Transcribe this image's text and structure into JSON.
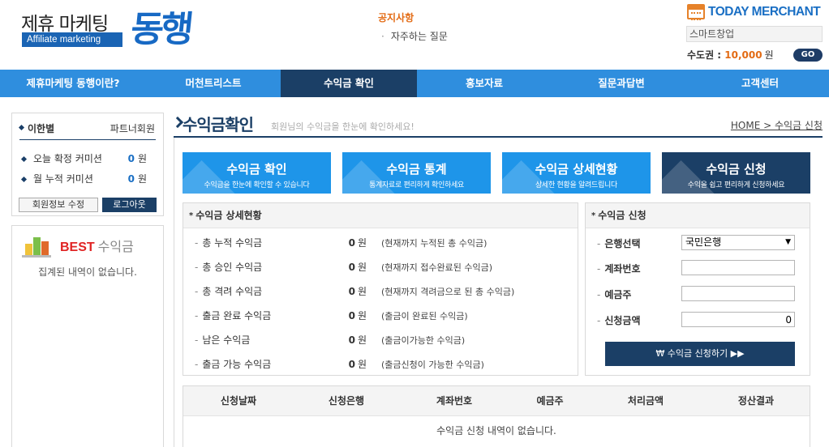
{
  "header": {
    "logo_main": "제휴 마케팅",
    "logo_sub": "Affiliate marketing",
    "logo_big": "동행",
    "notice_title": "공지사항",
    "notice_item": "자주하는 질문",
    "merchant_logo": "TODAY MERCHANT",
    "startup_text": "스마트창업",
    "sudo_label": "수도권 :",
    "sudo_value": "10,000",
    "sudo_unit": "원",
    "go_label": "GO"
  },
  "nav": {
    "items": [
      {
        "label": "제휴마케팅 동행이란?"
      },
      {
        "label": "머천트리스트"
      },
      {
        "label": "수익금 확인"
      },
      {
        "label": "홍보자료"
      },
      {
        "label": "질문과답변"
      },
      {
        "label": "고객센터"
      }
    ],
    "active_color": "#1b3f66",
    "bar_color": "#2f8ede"
  },
  "sidebar": {
    "member_name": "이한별",
    "member_grade": "파트너회원",
    "commissions": [
      {
        "label": "오늘 확정 커미션",
        "value": "0",
        "unit": "원"
      },
      {
        "label": "월 누적 커미션",
        "value": "0",
        "unit": "원"
      }
    ],
    "edit_button": "회원정보 수정",
    "logout_button": "로그아웃",
    "best_word": "BEST",
    "best_rest": "수익금",
    "best_empty": "집계된 내역이 없습니다."
  },
  "page": {
    "title": "수익금확인",
    "subtitle": "회원님의 수익금을 한눈에 확인하세요!",
    "breadcrumb": "HOME > 수익금 신청"
  },
  "tabs": [
    {
      "title": "수익금 확인",
      "desc": "수익금을 한눈에 확인할 수 있습니다",
      "color": "#1e95e9"
    },
    {
      "title": "수익금 통계",
      "desc": "통계자료로 편리하게 확인하세요",
      "color": "#1e95e9"
    },
    {
      "title": "수익금 상세현황",
      "desc": "상세한 현황을 알려드립니다",
      "color": "#1e95e9"
    },
    {
      "title": "수익금 신청",
      "desc": "수익을 쉽고 편리하게 신청하세요",
      "color": "#1b3f66"
    }
  ],
  "detail": {
    "title": "수익금 상세현황",
    "rows": [
      {
        "label": "총 누적 수익금",
        "amount": "0",
        "unit": "원",
        "desc": "(현재까지 누적된 총 수익금)"
      },
      {
        "label": "총 승인 수익금",
        "amount": "0",
        "unit": "원",
        "desc": "(현재까지 접수완료된 수익금)"
      },
      {
        "label": "총 격려 수익금",
        "amount": "0",
        "unit": "원",
        "desc": "(현재까지 격려금으로 된 총 수익금)"
      },
      {
        "label": "출금 완료 수익금",
        "amount": "0",
        "unit": "원",
        "desc": "(출금이 완료된 수익금)"
      },
      {
        "label": "남은 수익금",
        "amount": "0",
        "unit": "원",
        "desc": "(출금이가능한 수익금)"
      },
      {
        "label": "출금 가능 수익금",
        "amount": "0",
        "unit": "원",
        "desc": "(출금신청이 가능한 수익금)"
      }
    ]
  },
  "apply": {
    "title": "수익금 신청",
    "bank_label": "은행선택",
    "bank_value": "국민은행",
    "account_label": "계좌번호",
    "account_value": "",
    "holder_label": "예금주",
    "holder_value": "",
    "amount_label": "신청금액",
    "amount_value": "0",
    "submit": "₩ 수익금 신청하기 ▶▶"
  },
  "history": {
    "columns": [
      "신청날짜",
      "신청은행",
      "계좌번호",
      "예금주",
      "처리금액",
      "정산결과"
    ],
    "empty": "수익금 신청 내역이 없습니다."
  }
}
